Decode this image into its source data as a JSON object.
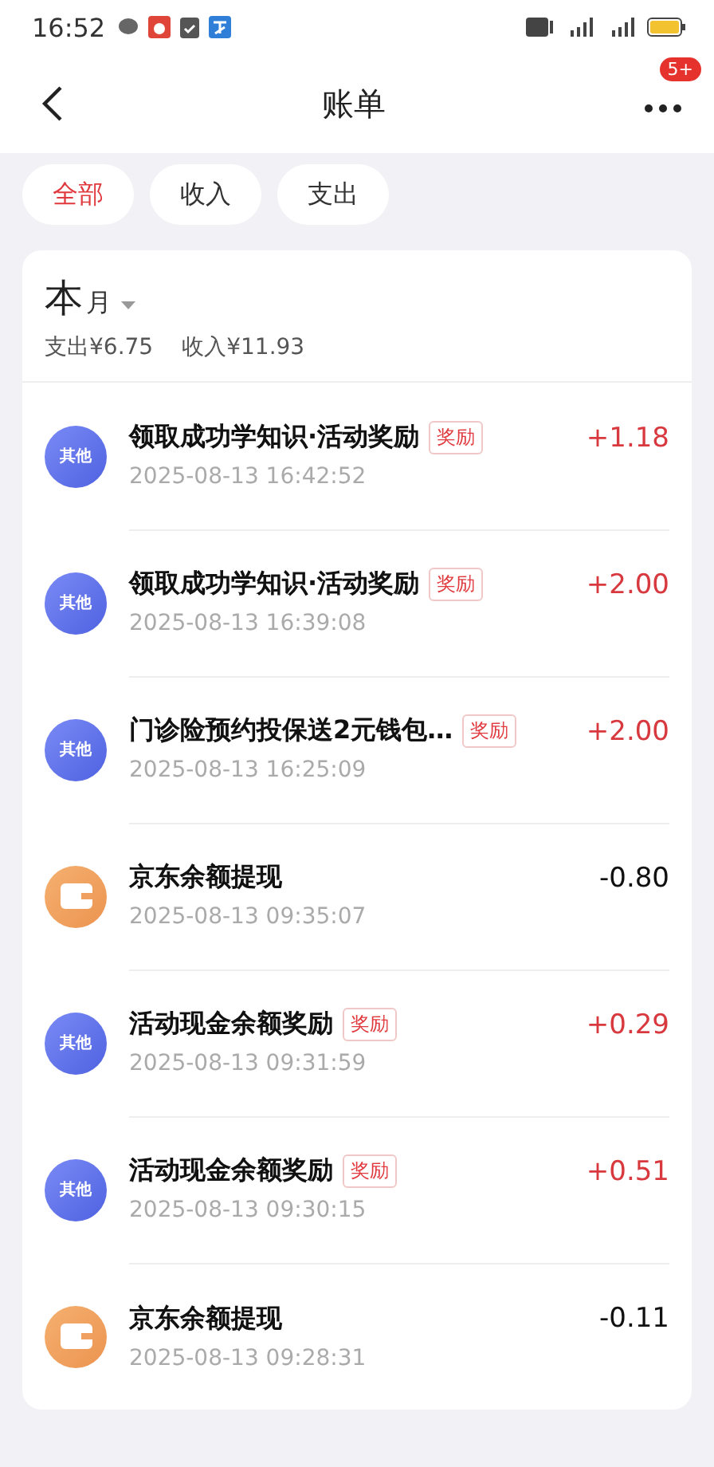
{
  "status_bar": {
    "time": "16:52"
  },
  "header": {
    "title": "账单",
    "badge": "5+"
  },
  "filters": [
    {
      "label": "全部",
      "selected": true
    },
    {
      "label": "收入",
      "selected": false
    },
    {
      "label": "支出",
      "selected": false
    }
  ],
  "summary": {
    "period": "本",
    "period_unit": "月",
    "expense": "支出¥6.75",
    "income": "收入¥11.93"
  },
  "records": [
    {
      "kind": "other",
      "avatar": "其他",
      "title": "领取成功学知识·活动奖励",
      "tag": "奖励",
      "date": "2025-08-13 16:42:52",
      "amount": "+1.18",
      "income": true
    },
    {
      "kind": "other",
      "avatar": "其他",
      "title": "领取成功学知识·活动奖励",
      "tag": "奖励",
      "date": "2025-08-13 16:39:08",
      "amount": "+2.00",
      "income": true
    },
    {
      "kind": "other",
      "avatar": "其他",
      "title": "门诊险预约投保送2元钱包…",
      "tag": "奖励",
      "date": "2025-08-13 16:25:09",
      "amount": "+2.00",
      "income": true
    },
    {
      "kind": "wallet",
      "title": "京东余额提现",
      "date": "2025-08-13 09:35:07",
      "amount": "-0.80",
      "income": false
    },
    {
      "kind": "other",
      "avatar": "其他",
      "title": "活动现金余额奖励",
      "tag": "奖励",
      "date": "2025-08-13 09:31:59",
      "amount": "+0.29",
      "income": true
    },
    {
      "kind": "other",
      "avatar": "其他",
      "title": "活动现金余额奖励",
      "tag": "奖励",
      "date": "2025-08-13 09:30:15",
      "amount": "+0.51",
      "income": true
    },
    {
      "kind": "wallet",
      "title": "京东余额提现",
      "date": "2025-08-13 09:28:31",
      "amount": "-0.11",
      "income": false
    }
  ]
}
